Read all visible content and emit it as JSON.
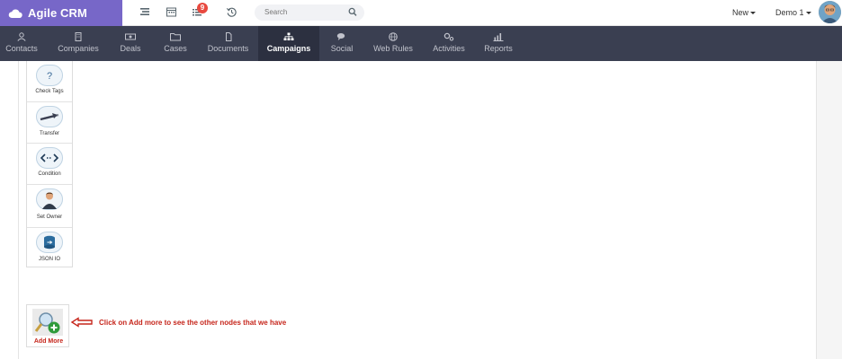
{
  "brand": {
    "name": "Agile CRM"
  },
  "topbar": {
    "notifications_count": "9",
    "search_placeholder": "Search",
    "new_label": "New",
    "user_label": "Demo 1"
  },
  "nav": {
    "items": [
      {
        "label": "Contacts",
        "icon": "user-icon"
      },
      {
        "label": "Companies",
        "icon": "building-icon"
      },
      {
        "label": "Deals",
        "icon": "money-icon"
      },
      {
        "label": "Cases",
        "icon": "folder-icon"
      },
      {
        "label": "Documents",
        "icon": "file-icon"
      },
      {
        "label": "Campaigns",
        "icon": "sitemap-icon",
        "active": true
      },
      {
        "label": "Social",
        "icon": "comments-icon"
      },
      {
        "label": "Web Rules",
        "icon": "globe-icon"
      },
      {
        "label": "Activities",
        "icon": "cogs-icon"
      },
      {
        "label": "Reports",
        "icon": "bar-chart-icon"
      }
    ]
  },
  "palette": {
    "nodes": [
      {
        "label": "Check Tags",
        "icon": "question-icon"
      },
      {
        "label": "Transfer",
        "icon": "transfer-arrows-icon"
      },
      {
        "label": "Condition",
        "icon": "condition-arrows-icon"
      },
      {
        "label": "Set Owner",
        "icon": "owner-person-icon"
      },
      {
        "label": "JSON IO",
        "icon": "database-arrow-icon"
      }
    ]
  },
  "add_more": {
    "label": "Add More"
  },
  "hint": {
    "text": "Click on Add more to see the other nodes that we have"
  },
  "colors": {
    "brand": "#7767c8",
    "navbar": "#3a3f51",
    "hint": "#c6261c"
  }
}
